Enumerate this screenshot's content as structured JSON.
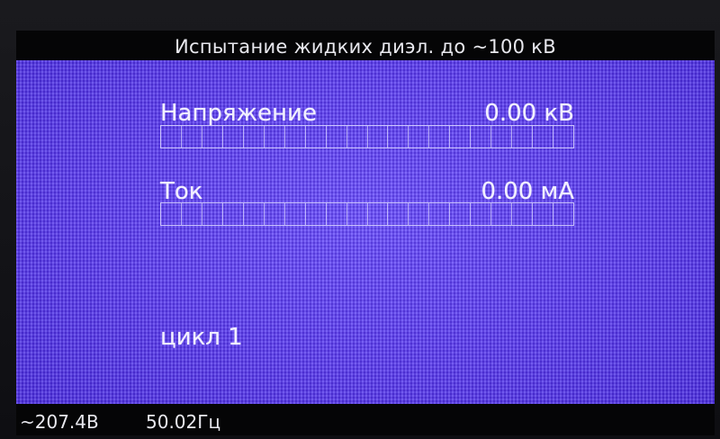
{
  "header": {
    "title": "Испытание жидких диэл. до ~100 кВ"
  },
  "voltage": {
    "label": "Напряжение",
    "value": "0.00 кВ",
    "level": 0,
    "segments": 20
  },
  "current": {
    "label": "Ток",
    "value": "0.00 мА",
    "level": 0,
    "segments": 20
  },
  "cycle": {
    "text": "цикл 1"
  },
  "status": {
    "mains_voltage": "~207.4В",
    "mains_frequency": "50.02Гц"
  },
  "colors": {
    "screen_background": "#5a3cf0",
    "text": "#f2f0ff",
    "bar_background": "#050506"
  }
}
